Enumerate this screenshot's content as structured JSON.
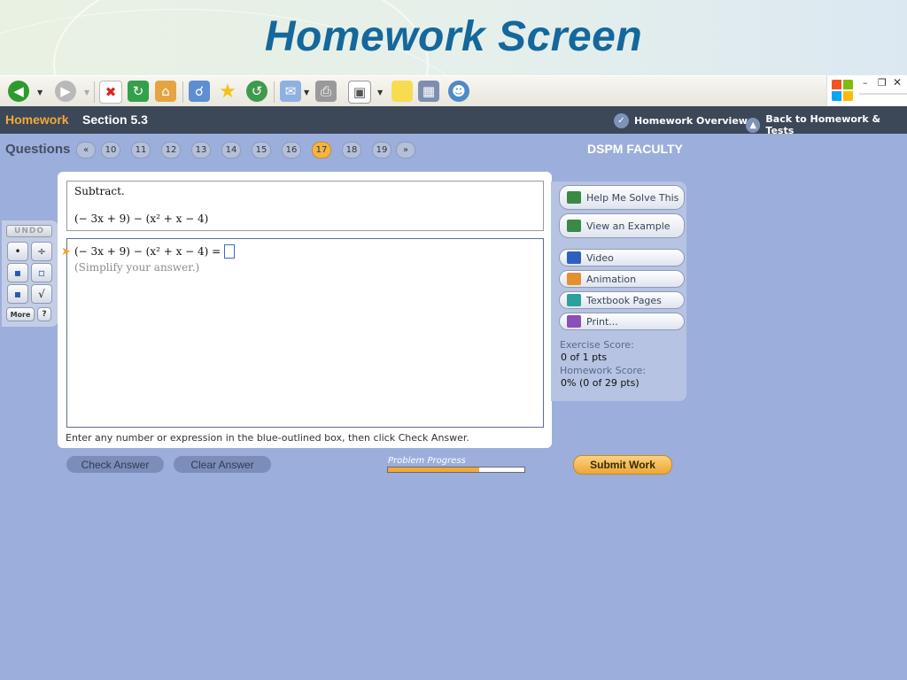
{
  "banner": {
    "title": "Homework Screen"
  },
  "header": {
    "homework_label": "Homework",
    "section_label": "Section 5.3",
    "overview_link": "Homework Overview",
    "back_link": "Back to Homework & Tests"
  },
  "questions": {
    "label": "Questions",
    "numbers": [
      "10",
      "11",
      "12",
      "13",
      "14",
      "15",
      "16",
      "17",
      "18",
      "19"
    ],
    "current": "17",
    "prev_icon": "«",
    "next_icon": "»"
  },
  "user": {
    "name": "DSPM FACULTY"
  },
  "palette": {
    "undo": "UNDO",
    "more": "More",
    "help": "?",
    "icons": [
      "dot-icon",
      "divide-icon",
      "fraction-icon",
      "mixed-number-icon",
      "exponent-icon",
      "sqrt-icon"
    ]
  },
  "question": {
    "instruction": "Subtract.",
    "expression": "(− 3x + 9) − (x² + x − 4)"
  },
  "answer": {
    "expression": "(− 3x + 9) − (x² + x − 4) =",
    "value": "",
    "hint": "(Simplify your answer.)"
  },
  "footnote": "Enter any number or expression in the blue-outlined box, then click Check Answer.",
  "sidebar": {
    "help_me_solve": "Help Me Solve This",
    "view_example": "View an Example",
    "video": "Video",
    "animation": "Animation",
    "textbook": "Textbook Pages",
    "print": "Print...",
    "exercise_score_label": "Exercise Score:",
    "exercise_score_value": "0 of 1 pts",
    "homework_score_label": "Homework Score:",
    "homework_score_value": "0% (0 of 29 pts)"
  },
  "bottom": {
    "check_answer": "Check Answer",
    "clear_answer": "Clear Answer",
    "progress_label": "Problem Progress",
    "progress_fraction": 0.67,
    "submit": "Submit Work"
  },
  "colors": {
    "page_bg": "#9caedb",
    "header_bg": "#3c4758",
    "homework_orange": "#f4a93a",
    "title_blue": "#14689b",
    "current_question": "#f3b447"
  }
}
